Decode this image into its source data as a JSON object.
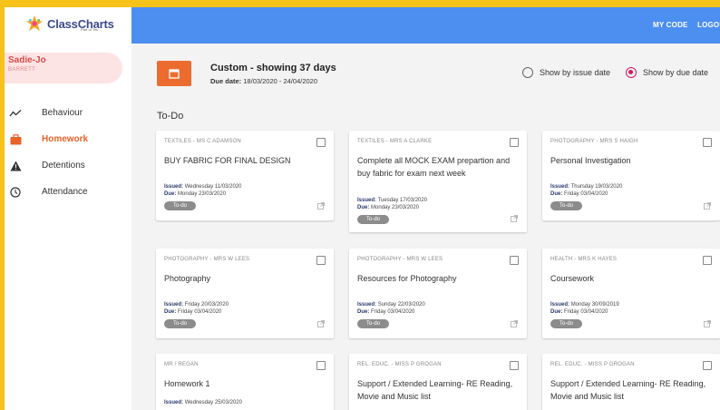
{
  "brand": {
    "name": "ClassCharts",
    "sub": "Part of Tes"
  },
  "user": {
    "first": "Sadie-Jo",
    "last": "BARRETT"
  },
  "nav": [
    {
      "label": "Behaviour",
      "icon": "trend-line-icon",
      "active": false
    },
    {
      "label": "Homework",
      "icon": "briefcase-icon",
      "active": true
    },
    {
      "label": "Detentions",
      "icon": "warning-icon",
      "active": false
    },
    {
      "label": "Attendance",
      "icon": "clock-icon",
      "active": false
    }
  ],
  "topbar": {
    "my_code": "MY CODE",
    "logout": "LOGOUT"
  },
  "filter": {
    "title": "Custom - showing 37 days",
    "due_label": "Due date:",
    "due_range": "18/03/2020 - 24/04/2020",
    "issue_option": "Show by issue date",
    "due_option": "Show by due date",
    "selected": "due"
  },
  "section": "To-Do",
  "colors": {
    "accent": "#ec6c2f",
    "topbar": "#4d8ef1",
    "radio": "#d81b60",
    "frame": "#f7c21a"
  },
  "cards": [
    {
      "teacher": "TEXTILES - MS C ADAMSON",
      "title": "BUY FABRIC FOR FINAL DESIGN",
      "issued": "Wednesday 11/03/2020",
      "due": "Monday 23/03/2020",
      "status": "To-do"
    },
    {
      "teacher": "TEXTILES - MRS A CLARKE",
      "title": "Complete all MOCK EXAM prepartion and buy fabric for exam next week",
      "issued": "Tuesday 17/03/2020",
      "due": "Monday 23/03/2020",
      "status": "To-do"
    },
    {
      "teacher": "PHOTOGRAPHY - MRS S HAIGH",
      "title": "Personal Investigation",
      "issued": "Thursday 19/03/2020",
      "due": "Friday 03/04/2020",
      "status": "To-do"
    },
    {
      "teacher": "PHOTOGRAPHY - MRS W LEES",
      "title": "Photography",
      "issued": "Friday 20/03/2020",
      "due": "Friday 03/04/2020",
      "status": "To-do"
    },
    {
      "teacher": "PHOTOGRAPHY - MRS W LEES",
      "title": "Resources for Photography",
      "issued": "Sunday 22/03/2020",
      "due": "Friday 03/04/2020",
      "status": "To-do"
    },
    {
      "teacher": "HEALTH - MRS K HAYES",
      "title": "Coursework",
      "issued": "Monday 30/09/2019",
      "due": "Friday 03/04/2020",
      "status": "To-do"
    },
    {
      "teacher": "MR / REGAN",
      "title": "Homework 1",
      "issued": "Wednesday 25/03/2020",
      "due": "",
      "status": ""
    },
    {
      "teacher": "REL. EDUC. - MISS P GROGAN",
      "title": "Support / Extended Learning- RE Reading, Movie and Music list",
      "issued": "",
      "due": "",
      "status": ""
    },
    {
      "teacher": "REL. EDUC. - MISS P GROGAN",
      "title": "Support / Extended Learning- RE Reading, Movie and Music list",
      "issued": "",
      "due": "",
      "status": ""
    }
  ],
  "labels": {
    "issued": "Issued:",
    "due": "Due:"
  }
}
